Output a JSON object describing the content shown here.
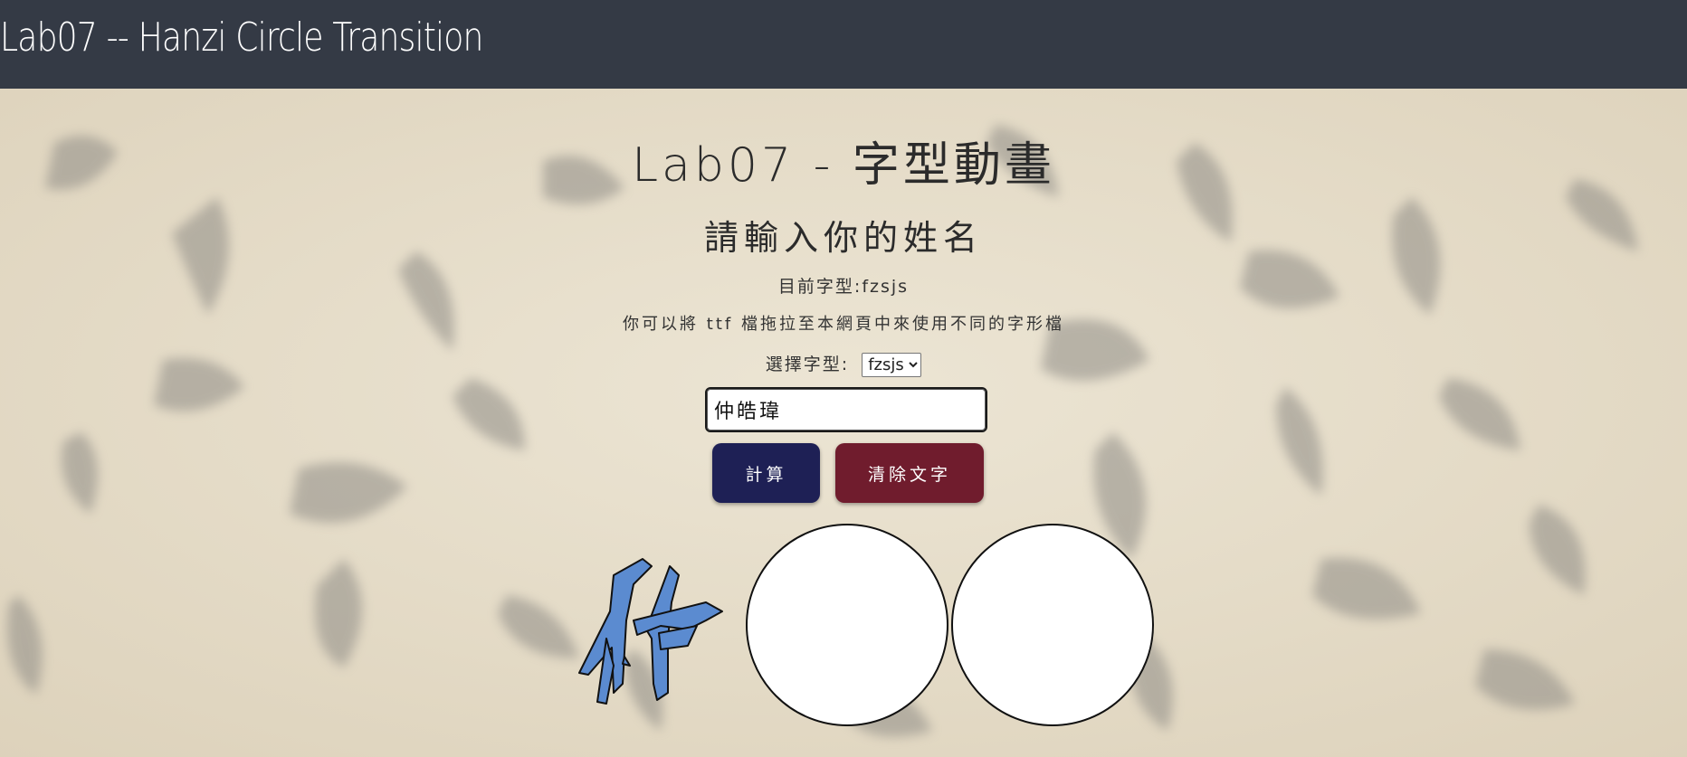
{
  "header": {
    "title": "Lab07 -- Hanzi Circle Transition"
  },
  "main": {
    "heading": "Lab07 - 字型動畫",
    "subheading": "請輸入你的姓名",
    "current_font_label": "目前字型:",
    "current_font_value": "fzsjs",
    "hint": "你可以將 ttf 檔拖拉至本網頁中來使用不同的字形檔",
    "select_label": "選擇字型:",
    "select_value": "fzsjs",
    "name_input_value": "仲皓瑋",
    "calc_button": "計算",
    "clear_button": "清除文字"
  },
  "colors": {
    "header_bg": "#343a45",
    "calc_button": "#1e2055",
    "clear_button": "#701c2d",
    "glyph_fill": "#5b8bd0"
  },
  "icons": {
    "glyph": "hanzi-zhong-glyph"
  }
}
